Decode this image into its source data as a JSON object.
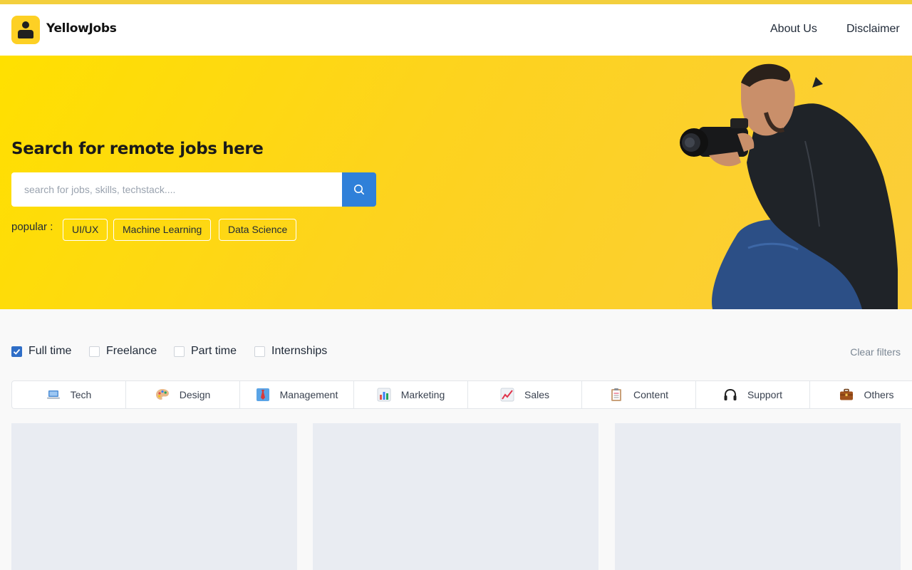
{
  "brand": {
    "name": "YellowJobs"
  },
  "nav": {
    "about": "About Us",
    "disclaimer": "Disclaimer"
  },
  "hero": {
    "title": "Search for remote jobs here",
    "search_placeholder": "search for jobs, skills, techstack....",
    "popular_label": "popular :",
    "popular_tags": [
      "UI/UX",
      "Machine Learning",
      "Data Science"
    ]
  },
  "filters": {
    "options": [
      {
        "label": "Full time",
        "checked": true
      },
      {
        "label": "Freelance",
        "checked": false
      },
      {
        "label": "Part time",
        "checked": false
      },
      {
        "label": "Internships",
        "checked": false
      }
    ],
    "clear_label": "Clear filters"
  },
  "categories": [
    {
      "label": "Tech",
      "icon": "laptop-icon"
    },
    {
      "label": "Design",
      "icon": "palette-icon"
    },
    {
      "label": "Management",
      "icon": "necktie-icon"
    },
    {
      "label": "Marketing",
      "icon": "bar-chart-icon"
    },
    {
      "label": "Sales",
      "icon": "trending-chart-icon"
    },
    {
      "label": "Content",
      "icon": "clipboard-icon"
    },
    {
      "label": "Support",
      "icon": "headphones-icon"
    },
    {
      "label": "Others",
      "icon": "briefcase-icon"
    }
  ],
  "colors": {
    "accent_yellow": "#fdd31e",
    "primary_blue": "#2f80d9",
    "checkbox_blue": "#2f6ec7"
  }
}
